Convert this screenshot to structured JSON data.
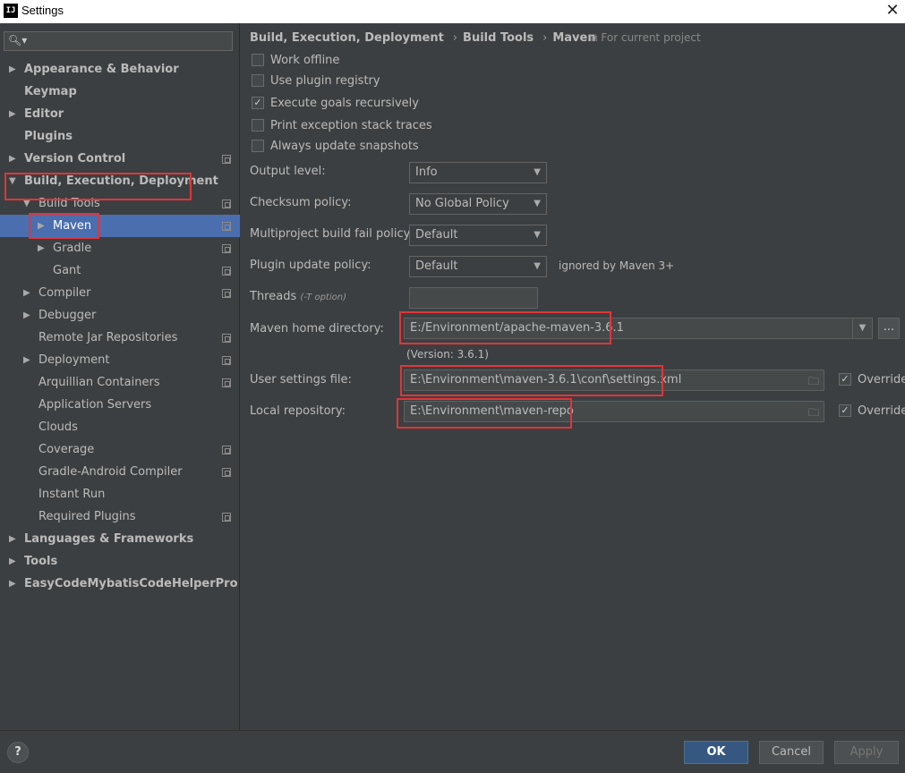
{
  "window": {
    "title": "Settings",
    "app_icon": "IJ"
  },
  "sidebar": {
    "items": [
      {
        "label": "Appearance & Behavior",
        "arrow": "▶",
        "bold": true
      },
      {
        "label": "Keymap",
        "bold": true
      },
      {
        "label": "Editor",
        "arrow": "▶",
        "bold": true
      },
      {
        "label": "Plugins",
        "bold": true
      },
      {
        "label": "Version Control",
        "arrow": "▶",
        "bold": true
      },
      {
        "label": "Build, Execution, Deployment",
        "arrow": "▼",
        "bold": true
      },
      {
        "label": "Build Tools",
        "arrow": "▼"
      },
      {
        "label": "Maven",
        "arrow": "▶",
        "selected": true
      },
      {
        "label": "Gradle",
        "arrow": "▶"
      },
      {
        "label": "Gant"
      },
      {
        "label": "Compiler",
        "arrow": "▶"
      },
      {
        "label": "Debugger",
        "arrow": "▶"
      },
      {
        "label": "Remote Jar Repositories"
      },
      {
        "label": "Deployment",
        "arrow": "▶"
      },
      {
        "label": "Arquillian Containers"
      },
      {
        "label": "Application Servers"
      },
      {
        "label": "Clouds"
      },
      {
        "label": "Coverage"
      },
      {
        "label": "Gradle-Android Compiler"
      },
      {
        "label": "Instant Run"
      },
      {
        "label": "Required Plugins"
      },
      {
        "label": "Languages & Frameworks",
        "arrow": "▶",
        "bold": true
      },
      {
        "label": "Tools",
        "arrow": "▶",
        "bold": true
      },
      {
        "label": "EasyCodeMybatisCodeHelperPro",
        "arrow": "▶",
        "bold": true
      }
    ]
  },
  "breadcrumb": {
    "part1": "Build, Execution, Deployment",
    "part2": "Build Tools",
    "part3": "Maven",
    "separator": "›",
    "scope_note": "For current project"
  },
  "checkboxes": [
    {
      "label": "Work offline",
      "checked": false
    },
    {
      "label": "Use plugin registry",
      "checked": false
    },
    {
      "label": "Execute goals recursively",
      "checked": true
    },
    {
      "label": "Print exception stack traces",
      "checked": false
    },
    {
      "label": "Always update snapshots",
      "checked": false
    }
  ],
  "form": {
    "output_level": {
      "label": "Output level:",
      "value": "Info"
    },
    "checksum_policy": {
      "label": "Checksum policy:",
      "value": "No Global Policy"
    },
    "multiproject_fail": {
      "label": "Multiproject build fail policy:",
      "value": "Default"
    },
    "plugin_update": {
      "label": "Plugin update policy:",
      "value": "Default",
      "note": "ignored by Maven 3+"
    },
    "threads": {
      "label": "Threads",
      "hint": "(-T option)",
      "value": ""
    },
    "maven_home": {
      "label": "Maven home directory:",
      "value": "E:/Environment/apache-maven-3.6.1",
      "version": "(Version: 3.6.1)",
      "browse": "..."
    },
    "user_settings": {
      "label": "User settings file:",
      "value": "E:\\Environment\\maven-3.6.1\\conf\\settings.xml",
      "override_label": "Override",
      "override_checked": true
    },
    "local_repo": {
      "label": "Local repository:",
      "value": "E:\\Environment\\maven-repo",
      "override_label": "Override",
      "override_checked": true
    }
  },
  "buttons": {
    "help": "?",
    "ok": "OK",
    "cancel": "Cancel",
    "apply": "Apply"
  },
  "colors": {
    "selection": "#4b6eaf",
    "highlight": "#e0353a",
    "ok_button": "#365880",
    "background": "#3c3f41"
  }
}
